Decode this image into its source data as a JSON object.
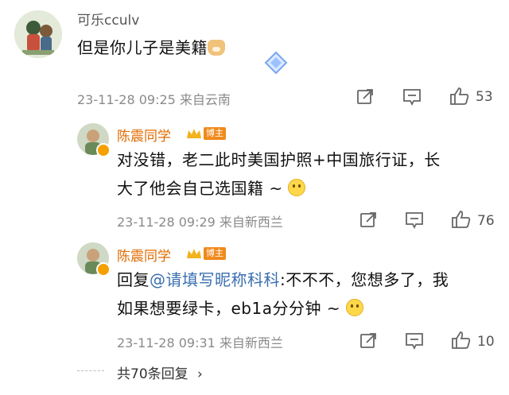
{
  "comment": {
    "username": "可乐cculv",
    "text": "但是你儿子是美籍",
    "emoji": "doge-emoji",
    "timestamp": "23-11-28 09:25",
    "location": "来自云南",
    "likes": "53"
  },
  "replies": [
    {
      "username": "陈震同学",
      "badge": "博主",
      "line1": "对没错，老二此时美国护照+中国旅行证，长",
      "line2": "大了他会自己选国籍 ~ ",
      "emoji": "smile-emoji",
      "timestamp": "23-11-28 09:29",
      "location": "来自新西兰",
      "likes": "76"
    },
    {
      "username": "陈震同学",
      "badge": "博主",
      "prefix": "回复",
      "mention": "@请填写昵称科科",
      "line1_rest": ":不不不，您想多了，我",
      "line2": "如果想要绿卡，eb1a分分钟 ~ ",
      "emoji": "smile-emoji",
      "timestamp": "23-11-28 09:31",
      "location": "来自新西兰",
      "likes": "10"
    }
  ],
  "more_replies": "共70条回复",
  "colors": {
    "author": "#e06b00",
    "mention": "#3a6fb0",
    "badge": "#f08a1c"
  }
}
